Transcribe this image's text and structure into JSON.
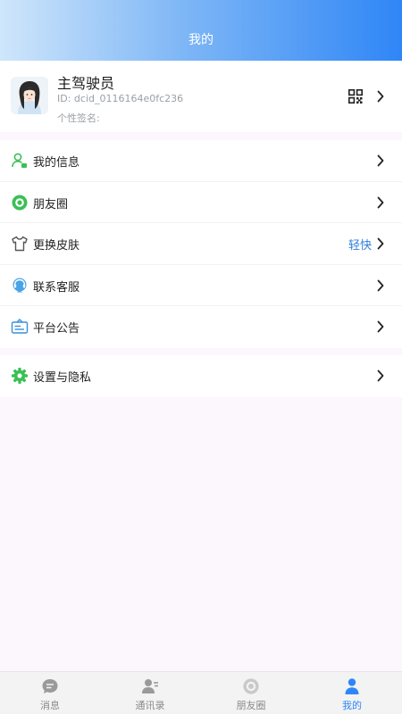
{
  "header": {
    "title": "我的"
  },
  "profile": {
    "name": "主驾驶员",
    "id_text": "ID:  dcid_0116164e0fc236",
    "signature_label": "个性签名:"
  },
  "menu_group_1": [
    {
      "label": "我的信息",
      "icon": "user-info-icon",
      "value": ""
    },
    {
      "label": "朋友圈",
      "icon": "moments-icon",
      "value": ""
    },
    {
      "label": "更换皮肤",
      "icon": "tshirt-icon",
      "value": "轻快"
    },
    {
      "label": "联系客服",
      "icon": "customer-service-icon",
      "value": ""
    },
    {
      "label": "平台公告",
      "icon": "announcement-icon",
      "value": ""
    }
  ],
  "menu_group_2": [
    {
      "label": "设置与隐私",
      "icon": "settings-icon",
      "value": ""
    }
  ],
  "tabbar": [
    {
      "label": "消息",
      "icon": "chat-icon",
      "active": false
    },
    {
      "label": "通讯录",
      "icon": "contacts-icon",
      "active": false
    },
    {
      "label": "朋友圈",
      "icon": "moments-icon",
      "active": false
    },
    {
      "label": "我的",
      "icon": "profile-icon",
      "active": true
    }
  ],
  "colors": {
    "accent": "#2f86f6",
    "green": "#3cbf55",
    "value_text": "#2f7fd8",
    "page_bg": "#fcf6fd"
  }
}
